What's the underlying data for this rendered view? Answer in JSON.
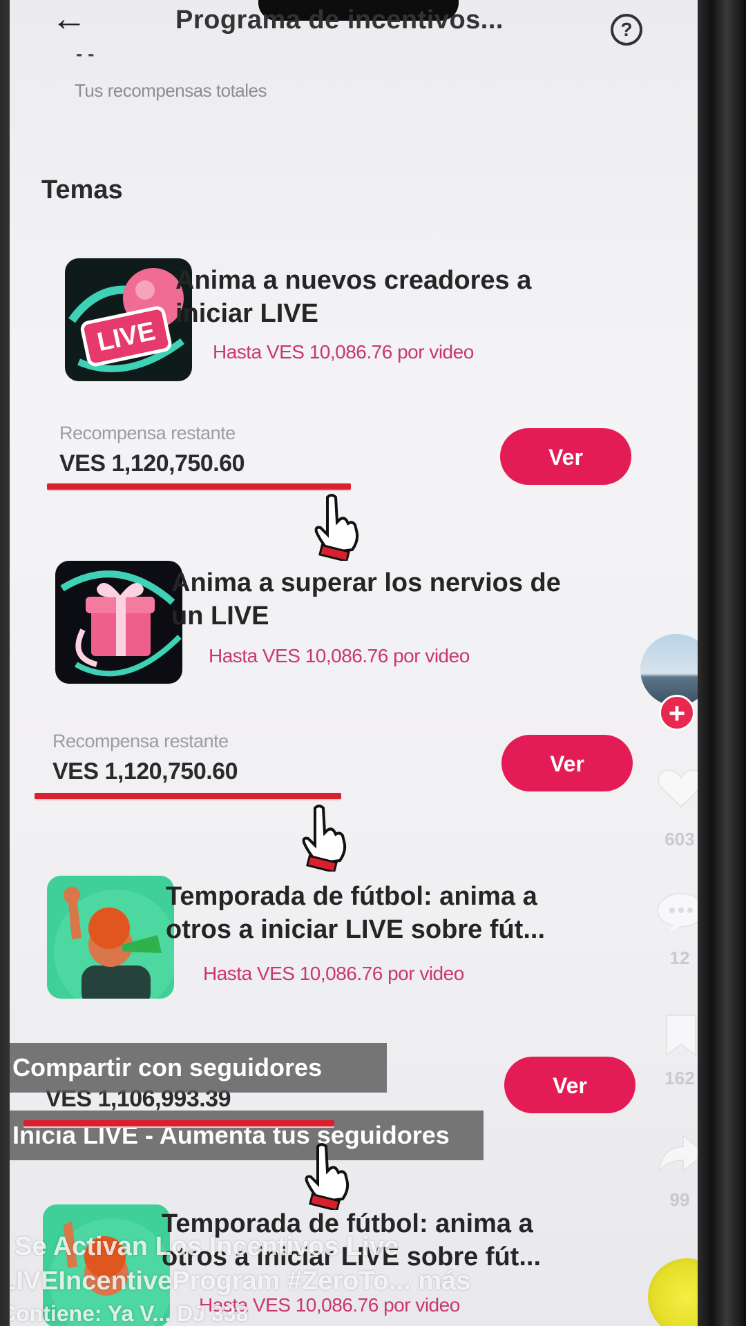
{
  "header": {
    "title": "Programa de incentivos...",
    "dash": "- -",
    "total_rewards_label": "Tus recompensas totales"
  },
  "section_title": "Temas",
  "cards": [
    {
      "thumb": "live-badge",
      "title_line1": "Anima a nuevos creadores a",
      "title_line2": "iniciar LIVE",
      "subtitle": "Hasta VES 10,086.76 por video",
      "remaining_label": "Recompensa restante",
      "remaining_value": "VES 1,120,750.60",
      "button": "Ver"
    },
    {
      "thumb": "gift-box",
      "title_line1": "Anima a superar los nervios de",
      "title_line2": "un LIVE",
      "subtitle": "Hasta VES 10,086.76 por video",
      "remaining_label": "Recompensa restante",
      "remaining_value": "VES 1,120,750.60",
      "button": "Ver"
    },
    {
      "thumb": "football-fan",
      "title_line1": "Temporada de fútbol: anima a",
      "title_line2": "otros a iniciar LIVE sobre fút...",
      "subtitle": "Hasta VES 10,086.76 por video",
      "remaining_value": "VES 1,106,993.39",
      "button": "Ver"
    },
    {
      "thumb": "football-fan",
      "title_line1": "Temporada de fútbol: anima a",
      "title_line2": "otros a iniciar LIVE sobre fút...",
      "subtitle": "Hasta VES 10,086.76 por video"
    }
  ],
  "thumb_labels": {
    "live": "LIVE"
  },
  "side": {
    "follow": "+",
    "likes": "603",
    "comments": "12",
    "saves": "162",
    "shares": "99"
  },
  "overlays": {
    "share_caption": "Compartir con seguidores",
    "live_caption": "Inicia LIVE - Aumenta tus seguidores",
    "desc_line1": "/ Se Activan Los Incentivos Live",
    "desc_line2": "LIVEIncentiveProgram #ZeroTo... más",
    "desc_line3": "Contiene: Ya V... DJ 338"
  },
  "icons": {
    "back": "←",
    "help": "?",
    "hand": "hand-pointer-icon"
  },
  "colors": {
    "accent": "#e41c55",
    "subtitle": "#c9386a",
    "underline": "#d9202f"
  }
}
